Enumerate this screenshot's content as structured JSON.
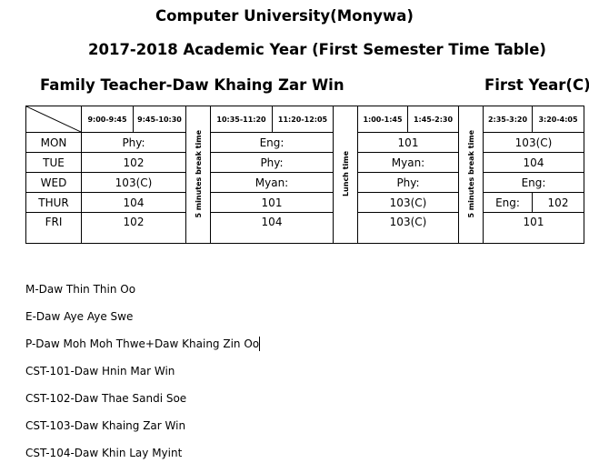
{
  "header": {
    "institution": "Computer University(Monywa)",
    "subtitle": "2017-2018 Academic Year (First Semester Time Table)",
    "family_teacher": "Family Teacher-Daw Khaing Zar Win",
    "class": "First Year(C)"
  },
  "timetable": {
    "periods": {
      "p1": "9:00-9:45",
      "p2": "9:45-10:30",
      "p3": "10:35-11:20",
      "p4": "11:20-12:05",
      "p5": "1:00-1:45",
      "p6": "1:45-2:30",
      "p7": "2:35-3:20",
      "p8": "3:20-4:05"
    },
    "breaks": {
      "morning": "5 minutes break time",
      "lunch": "Lunch time",
      "afternoon": "5 minutes break time"
    },
    "rows": [
      {
        "day": "MON",
        "s1": "Phy:",
        "s2": "Eng:",
        "s3": "101",
        "s4": "103(C)"
      },
      {
        "day": "TUE",
        "s1": "102",
        "s2": "Phy:",
        "s3": "Myan:",
        "s4": "104"
      },
      {
        "day": "WED",
        "s1": "103(C)",
        "s2": "Myan:",
        "s3": "Phy:",
        "s4": "Eng:"
      },
      {
        "day": "THUR",
        "s1": "104",
        "s2": "101",
        "s3": "103(C)",
        "s4a": "Eng:",
        "s4b": "102"
      },
      {
        "day": "FRI",
        "s1": "102",
        "s2": "104",
        "s3": "103(C)",
        "s4": "101"
      }
    ]
  },
  "teachers": [
    "M-Daw Thin Thin Oo",
    "E-Daw Aye Aye Swe",
    "P-Daw Moh Moh Thwe+Daw Khaing Zin Oo",
    "CST-101-Daw Hnin Mar Win",
    "CST-102-Daw Thae Sandi Soe",
    "CST-103-Daw Khaing Zar Win",
    "CST-104-Daw Khin Lay Myint"
  ]
}
